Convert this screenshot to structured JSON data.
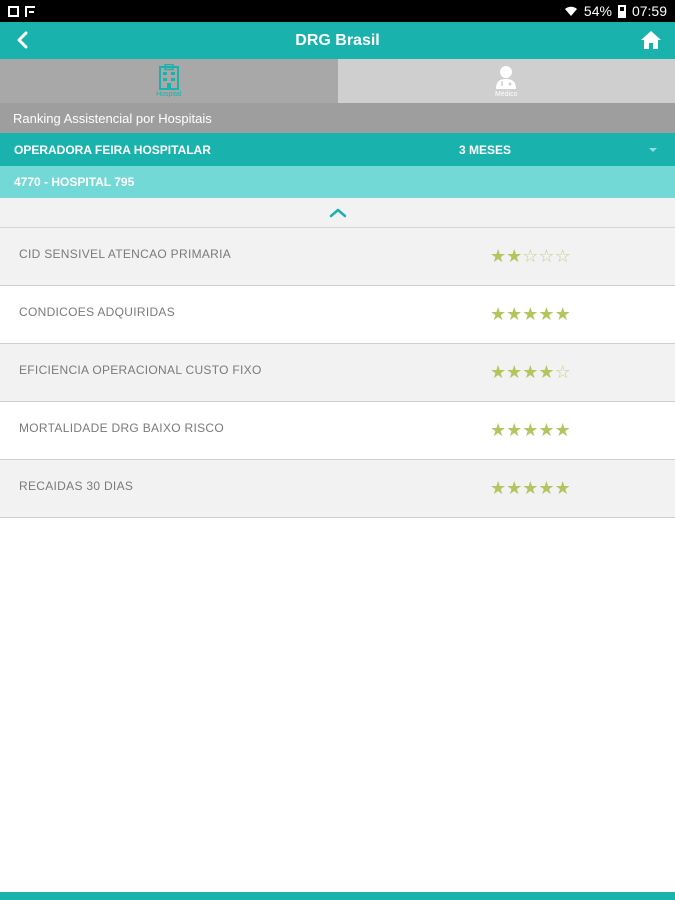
{
  "status_bar": {
    "battery": "54%",
    "time": "07:59",
    "icons": [
      "gallery-icon",
      "flag-icon",
      "wifi-icon",
      "battery-icon"
    ]
  },
  "app_bar": {
    "title": "DRG Brasil",
    "back_icon": "chevron-left-icon",
    "home_icon": "home-icon"
  },
  "tabs": [
    {
      "label": "Hospital",
      "icon": "hospital-building-icon",
      "active": true
    },
    {
      "label": "Médico",
      "icon": "doctor-icon",
      "active": false
    }
  ],
  "section": {
    "title": "Ranking Assistencial por Hospitais"
  },
  "filter": {
    "operator": "OPERADORA FEIRA HOSPITALAR",
    "period": "3 MESES"
  },
  "hospital": {
    "label": "4770 - HOSPITAL 795"
  },
  "rankings": [
    {
      "label": "CID SENSIVEL ATENCAO PRIMARIA",
      "stars": 2,
      "max": 5
    },
    {
      "label": "CONDICOES ADQUIRIDAS",
      "stars": 5,
      "max": 5
    },
    {
      "label": "EFICIENCIA OPERACIONAL CUSTO FIXO",
      "stars": 4,
      "max": 5
    },
    {
      "label": "MORTALIDADE DRG BAIXO RISCO",
      "stars": 5,
      "max": 5
    },
    {
      "label": "RECAIDAS 30 DIAS",
      "stars": 5,
      "max": 5
    }
  ],
  "colors": {
    "accent": "#1ab2ad",
    "accent_light": "#73d9d6",
    "star": "#b5c45e"
  }
}
